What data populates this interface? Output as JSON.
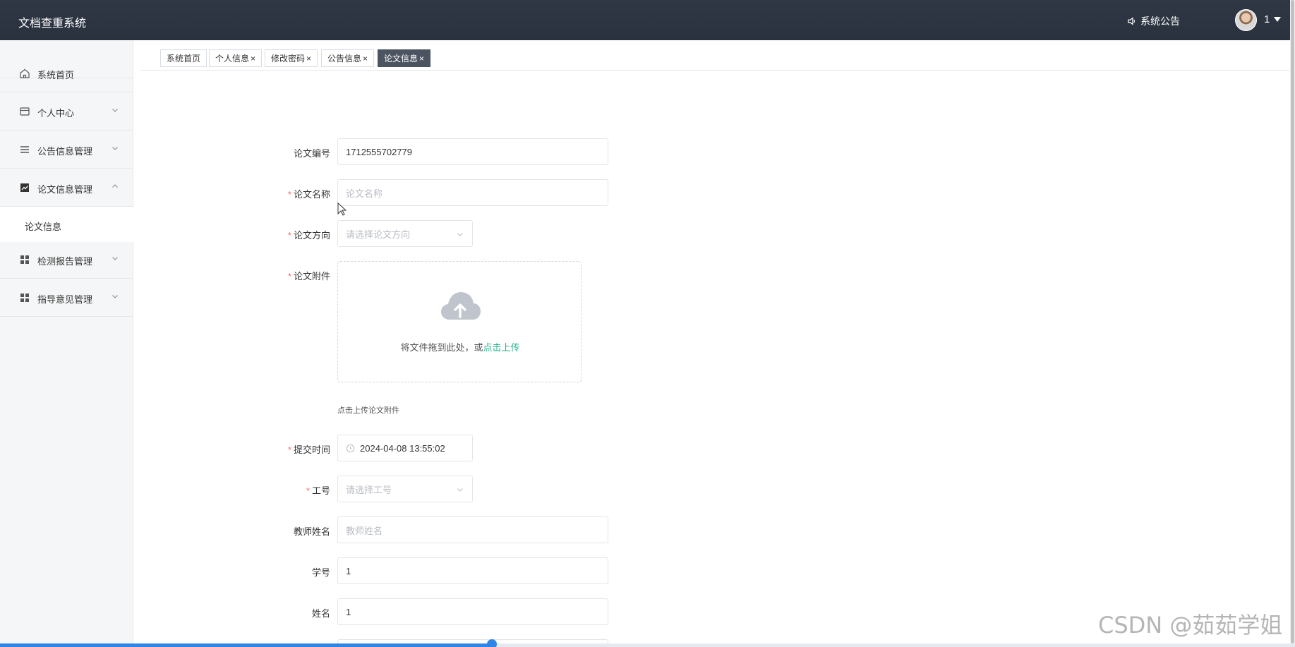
{
  "header": {
    "app_title": "文档查重系统",
    "notice_label": "系统公告",
    "user_name": "1"
  },
  "sidebar": {
    "items": [
      {
        "label": "系统首页",
        "icon": "home-icon",
        "expandable": false
      },
      {
        "label": "个人中心",
        "icon": "card-icon",
        "expandable": true,
        "expanded": false
      },
      {
        "label": "公告信息管理",
        "icon": "list-icon",
        "expandable": true,
        "expanded": false
      },
      {
        "label": "论文信息管理",
        "icon": "chart-icon",
        "expandable": true,
        "expanded": true
      },
      {
        "label": "检测报告管理",
        "icon": "grid-icon",
        "expandable": true,
        "expanded": false
      },
      {
        "label": "指导意见管理",
        "icon": "grid-icon",
        "expandable": true,
        "expanded": false
      }
    ],
    "subitem": "论文信息"
  },
  "tabs": [
    {
      "label": "系统首页",
      "closable": false,
      "active": false
    },
    {
      "label": "个人信息",
      "closable": true,
      "active": false
    },
    {
      "label": "修改密码",
      "closable": true,
      "active": false
    },
    {
      "label": "公告信息",
      "closable": true,
      "active": false
    },
    {
      "label": "论文信息",
      "closable": true,
      "active": true
    }
  ],
  "tab_close": "×",
  "form": {
    "paper_no": {
      "label": "论文编号",
      "value": "1712555702779"
    },
    "paper_name": {
      "label": "论文名称",
      "required": true,
      "placeholder": "论文名称"
    },
    "paper_direction": {
      "label": "论文方向",
      "required": true,
      "placeholder": "请选择论文方向"
    },
    "attachment": {
      "label": "论文附件",
      "required": true,
      "upload_text": "将文件拖到此处，或",
      "upload_link": "点击上传",
      "hint": "点击上传论文附件"
    },
    "submit_time": {
      "label": "提交时间",
      "required": true,
      "value": "2024-04-08 13:55:02"
    },
    "work_no": {
      "label": "工号",
      "required": true,
      "placeholder": "请选择工号"
    },
    "teacher_name": {
      "label": "教师姓名",
      "placeholder": "教师姓名"
    },
    "student_no": {
      "label": "学号",
      "value": "1"
    },
    "student_name": {
      "label": "姓名",
      "value": "1"
    }
  },
  "required_mark": "*",
  "video_progress": 0.38,
  "watermark": "CSDN @茹茹学姐",
  "colors": {
    "header_bg": "#2f3744",
    "accent": "#27b18f",
    "active_tab": "#4c5461",
    "required": "#f56c6c",
    "progress": "#2e85e8"
  }
}
